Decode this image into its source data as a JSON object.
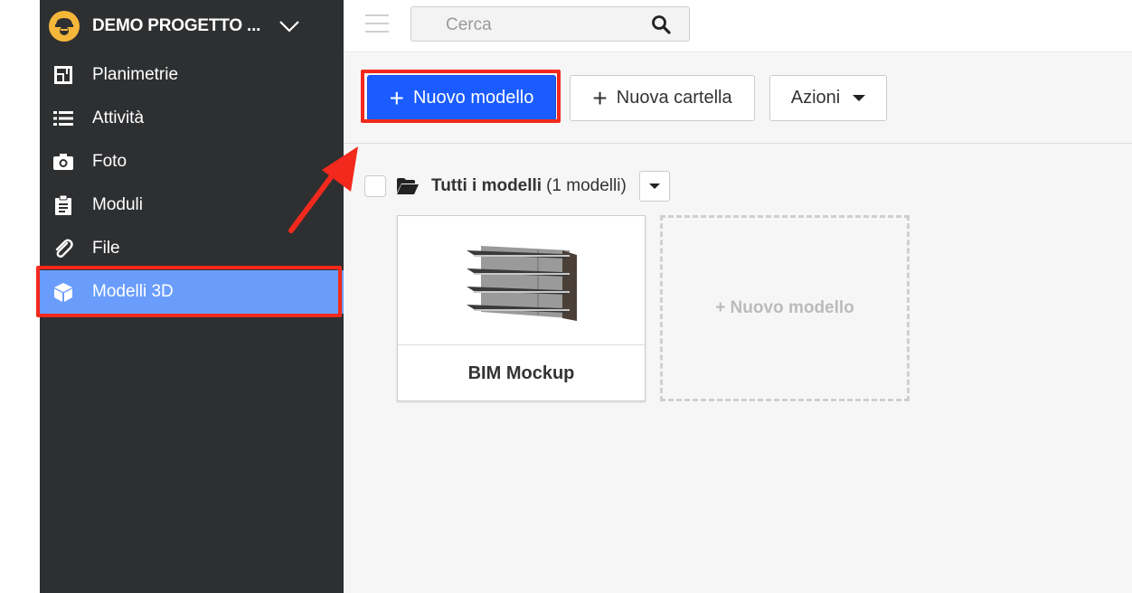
{
  "project": {
    "name": "DEMO PROGETTO ...",
    "logo_icon": "worker-helmet-icon"
  },
  "sidebar": {
    "items": [
      {
        "label": "Planimetrie",
        "icon": "floorplan-icon"
      },
      {
        "label": "Attività",
        "icon": "list-icon"
      },
      {
        "label": "Foto",
        "icon": "camera-icon"
      },
      {
        "label": "Moduli",
        "icon": "clipboard-icon"
      },
      {
        "label": "File",
        "icon": "paperclip-icon"
      },
      {
        "label": "Modelli 3D",
        "icon": "cube-icon",
        "active": true
      }
    ]
  },
  "search": {
    "placeholder": "Cerca"
  },
  "toolbar": {
    "new_model": "Nuovo modello",
    "new_folder": "Nuova cartella",
    "actions": "Azioni"
  },
  "folder": {
    "title": "Tutti i modelli",
    "count": "(1 modelli)"
  },
  "cards": [
    {
      "title": "BIM Mockup"
    }
  ],
  "new_card": {
    "label": "+ Nuovo modello"
  },
  "colors": {
    "sidebar": "#2e2f31",
    "active": "#6a9dfb",
    "primary": "#1a5cff",
    "highlight": "#f2291c",
    "logo": "#f5b73a"
  }
}
